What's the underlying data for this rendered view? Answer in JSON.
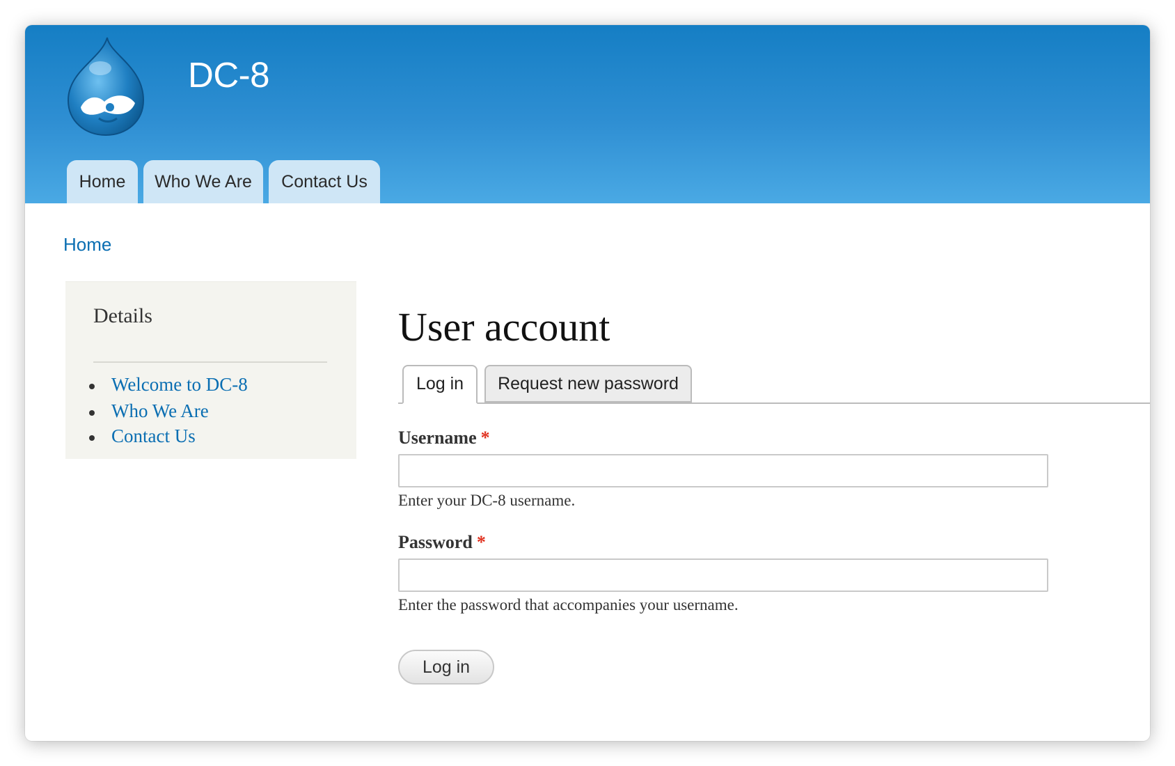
{
  "site": {
    "name": "DC-8",
    "logo_icon": "drupal-drop-icon"
  },
  "nav": {
    "tabs": [
      {
        "label": "Home"
      },
      {
        "label": "Who We Are"
      },
      {
        "label": "Contact Us"
      }
    ]
  },
  "breadcrumb": {
    "label": "Home"
  },
  "sidebar": {
    "title": "Details",
    "links": [
      {
        "label": "Welcome to DC-8"
      },
      {
        "label": "Who We Are"
      },
      {
        "label": "Contact Us"
      }
    ]
  },
  "main": {
    "title": "User account",
    "tabs": [
      {
        "label": "Log in",
        "active": true
      },
      {
        "label": "Request new password",
        "active": false
      }
    ],
    "form": {
      "username": {
        "label": "Username",
        "required_marker": "*",
        "value": "",
        "help": "Enter your DC-8 username."
      },
      "password": {
        "label": "Password",
        "required_marker": "*",
        "value": "",
        "help": "Enter the password that accompanies your username."
      },
      "submit_label": "Log in"
    }
  },
  "colors": {
    "header_top": "#157ec4",
    "header_bottom": "#4aa9e4",
    "link": "#0a6eb2",
    "required": "#e0301e",
    "nav_tab": "#cfe6f6",
    "sidebar_bg": "#f4f4ef"
  }
}
